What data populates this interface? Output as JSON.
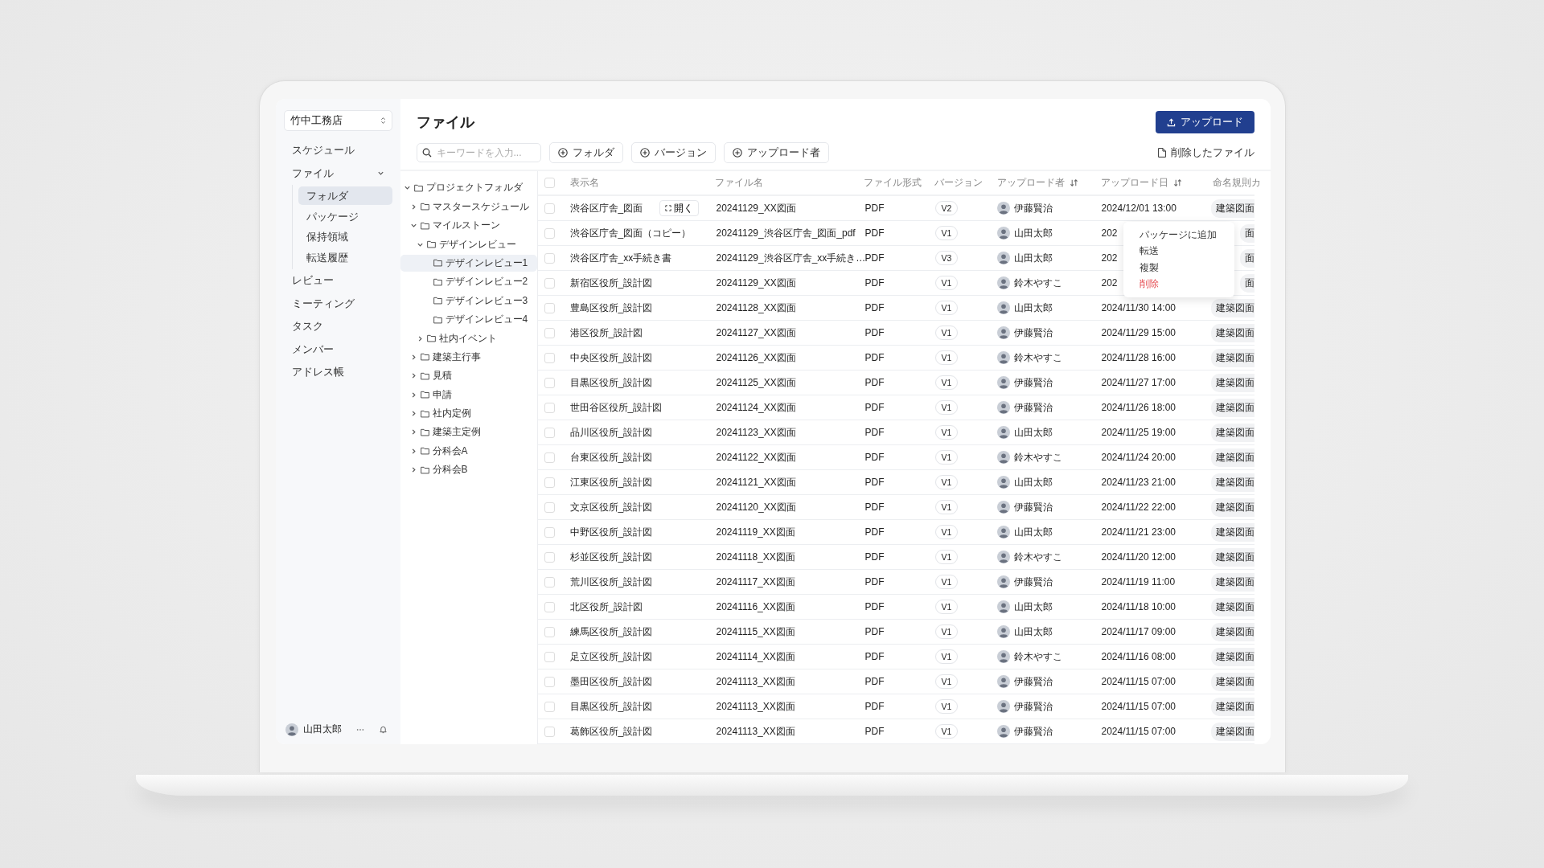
{
  "sidebar": {
    "org_select": {
      "value": "竹中工務店"
    },
    "items": [
      {
        "label": "スケジュール"
      },
      {
        "label": "ファイル",
        "expanded": true,
        "children": [
          {
            "label": "フォルダ",
            "selected": true
          },
          {
            "label": "パッケージ",
            "selected": false
          },
          {
            "label": "保持領域",
            "selected": false
          },
          {
            "label": "転送履歴",
            "selected": false
          }
        ]
      },
      {
        "label": "レビュー"
      },
      {
        "label": "ミーティング"
      },
      {
        "label": "タスク"
      },
      {
        "label": "メンバー"
      },
      {
        "label": "アドレス帳"
      }
    ],
    "user": {
      "name": "山田太郎"
    }
  },
  "page_title": "ファイル",
  "upload_button": "アップロード",
  "search": {
    "placeholder": "キーワードを入力..."
  },
  "filters": [
    "フォルダ",
    "バージョン",
    "アップロード者"
  ],
  "deleted_files_link": "削除したファイル",
  "folder_tree": [
    {
      "label": "プロジェクトフォルダ",
      "expanded": true,
      "selected": false,
      "children": [
        {
          "label": "マスタースケジュール",
          "expanded": false,
          "selected": false
        },
        {
          "label": "マイルストーン",
          "expanded": true,
          "selected": false,
          "children": [
            {
              "label": "デザインレビュー",
              "expanded": true,
              "selected": false,
              "children": [
                {
                  "label": "デザインレビュー1",
                  "selected": true
                },
                {
                  "label": "デザインレビュー2",
                  "selected": false
                },
                {
                  "label": "デザインレビュー3",
                  "selected": false
                },
                {
                  "label": "デザインレビュー4",
                  "selected": false
                }
              ]
            },
            {
              "label": "社内イベント",
              "expanded": false,
              "selected": false
            }
          ]
        },
        {
          "label": "建築主行事",
          "expanded": false,
          "selected": false
        },
        {
          "label": "見積",
          "expanded": false,
          "selected": false
        },
        {
          "label": "申請",
          "expanded": false,
          "selected": false
        },
        {
          "label": "社内定例",
          "expanded": false,
          "selected": false
        },
        {
          "label": "建築主定例",
          "expanded": false,
          "selected": false
        },
        {
          "label": "分科会A",
          "expanded": false,
          "selected": false
        },
        {
          "label": "分科会B",
          "expanded": false,
          "selected": false
        }
      ]
    }
  ],
  "table": {
    "header_checked": false,
    "columns": [
      {
        "label": "表示名",
        "sortable": false
      },
      {
        "label": "ファイル名",
        "sortable": false
      },
      {
        "label": "ファイル形式",
        "sortable": false
      },
      {
        "label": "バージョン",
        "sortable": false
      },
      {
        "label": "アップロード者",
        "sortable": true
      },
      {
        "label": "アップロード日",
        "sortable": true
      },
      {
        "label": "命名規則カ"
      }
    ],
    "rows": [
      {
        "checked": false,
        "name": "渋谷区庁舎_図面",
        "open_button": "開く",
        "file": "20241129_XX図面",
        "format": "PDF",
        "version": "V2",
        "uploader": "伊藤賢治",
        "date": "2024/12/01 13:00",
        "tag": "建築図面"
      },
      {
        "checked": false,
        "name": "渋谷区庁舎_図面（コピー）",
        "file": "20241129_渋谷区庁舎_図面_pdf",
        "format": "PDF",
        "version": "V1",
        "uploader": "山田太郎",
        "date": "202",
        "tag": "面"
      },
      {
        "checked": false,
        "name": "渋谷区庁舎_xx手続き書",
        "file": "20241129_渋谷区庁舎_xx手続き…",
        "format": "PDF",
        "version": "V3",
        "uploader": "山田太郎",
        "date": "202",
        "tag": "面"
      },
      {
        "checked": false,
        "name": "新宿区役所_設計図",
        "file": "20241129_XX図面",
        "format": "PDF",
        "version": "V1",
        "uploader": "鈴木やすこ",
        "date": "202",
        "tag": "面"
      },
      {
        "checked": false,
        "name": "豊島区役所_設計図",
        "file": "20241128_XX図面",
        "format": "PDF",
        "version": "V1",
        "uploader": "山田太郎",
        "date": "2024/11/30 14:00",
        "tag": "建築図面"
      },
      {
        "checked": false,
        "name": "港区役所_設計図",
        "file": "20241127_XX図面",
        "format": "PDF",
        "version": "V1",
        "uploader": "伊藤賢治",
        "date": "2024/11/29 15:00",
        "tag": "建築図面"
      },
      {
        "checked": false,
        "name": "中央区役所_設計図",
        "file": "20241126_XX図面",
        "format": "PDF",
        "version": "V1",
        "uploader": "鈴木やすこ",
        "date": "2024/11/28 16:00",
        "tag": "建築図面"
      },
      {
        "checked": false,
        "name": "目黒区役所_設計図",
        "file": "20241125_XX図面",
        "format": "PDF",
        "version": "V1",
        "uploader": "伊藤賢治",
        "date": "2024/11/27 17:00",
        "tag": "建築図面"
      },
      {
        "checked": false,
        "name": "世田谷区役所_設計図",
        "file": "20241124_XX図面",
        "format": "PDF",
        "version": "V1",
        "uploader": "伊藤賢治",
        "date": "2024/11/26 18:00",
        "tag": "建築図面"
      },
      {
        "checked": false,
        "name": "品川区役所_設計図",
        "file": "20241123_XX図面",
        "format": "PDF",
        "version": "V1",
        "uploader": "山田太郎",
        "date": "2024/11/25 19:00",
        "tag": "建築図面"
      },
      {
        "checked": false,
        "name": "台東区役所_設計図",
        "file": "20241122_XX図面",
        "format": "PDF",
        "version": "V1",
        "uploader": "鈴木やすこ",
        "date": "2024/11/24 20:00",
        "tag": "建築図面"
      },
      {
        "checked": false,
        "name": "江東区役所_設計図",
        "file": "20241121_XX図面",
        "format": "PDF",
        "version": "V1",
        "uploader": "山田太郎",
        "date": "2024/11/23 21:00",
        "tag": "建築図面"
      },
      {
        "checked": false,
        "name": "文京区役所_設計図",
        "file": "20241120_XX図面",
        "format": "PDF",
        "version": "V1",
        "uploader": "伊藤賢治",
        "date": "2024/11/22 22:00",
        "tag": "建築図面"
      },
      {
        "checked": false,
        "name": "中野区役所_設計図",
        "file": "20241119_XX図面",
        "format": "PDF",
        "version": "V1",
        "uploader": "山田太郎",
        "date": "2024/11/21 23:00",
        "tag": "建築図面"
      },
      {
        "checked": false,
        "name": "杉並区役所_設計図",
        "file": "20241118_XX図面",
        "format": "PDF",
        "version": "V1",
        "uploader": "鈴木やすこ",
        "date": "2024/11/20 12:00",
        "tag": "建築図面"
      },
      {
        "checked": false,
        "name": "荒川区役所_設計図",
        "file": "20241117_XX図面",
        "format": "PDF",
        "version": "V1",
        "uploader": "伊藤賢治",
        "date": "2024/11/19 11:00",
        "tag": "建築図面"
      },
      {
        "checked": false,
        "name": "北区役所_設計図",
        "file": "20241116_XX図面",
        "format": "PDF",
        "version": "V1",
        "uploader": "山田太郎",
        "date": "2024/11/18 10:00",
        "tag": "建築図面"
      },
      {
        "checked": false,
        "name": "練馬区役所_設計図",
        "file": "20241115_XX図面",
        "format": "PDF",
        "version": "V1",
        "uploader": "山田太郎",
        "date": "2024/11/17 09:00",
        "tag": "建築図面"
      },
      {
        "checked": false,
        "name": "足立区役所_設計図",
        "file": "20241114_XX図面",
        "format": "PDF",
        "version": "V1",
        "uploader": "鈴木やすこ",
        "date": "2024/11/16 08:00",
        "tag": "建築図面"
      },
      {
        "checked": false,
        "name": "墨田区役所_設計図",
        "file": "20241113_XX図面",
        "format": "PDF",
        "version": "V1",
        "uploader": "伊藤賢治",
        "date": "2024/11/15 07:00",
        "tag": "建築図面"
      },
      {
        "checked": false,
        "name": "目黒区役所_設計図",
        "file": "20241113_XX図面",
        "format": "PDF",
        "version": "V1",
        "uploader": "伊藤賢治",
        "date": "2024/11/15 07:00",
        "tag": "建築図面"
      },
      {
        "checked": false,
        "name": "葛飾区役所_設計図",
        "file": "20241113_XX図面",
        "format": "PDF",
        "version": "V1",
        "uploader": "伊藤賢治",
        "date": "2024/11/15 07:00",
        "tag": "建築図面"
      }
    ]
  },
  "context_menu": [
    {
      "label": "パッケージに追加",
      "kind": "normal"
    },
    {
      "label": "転送",
      "kind": "normal"
    },
    {
      "label": "複製",
      "kind": "normal"
    },
    {
      "label": "削除",
      "kind": "danger"
    }
  ]
}
